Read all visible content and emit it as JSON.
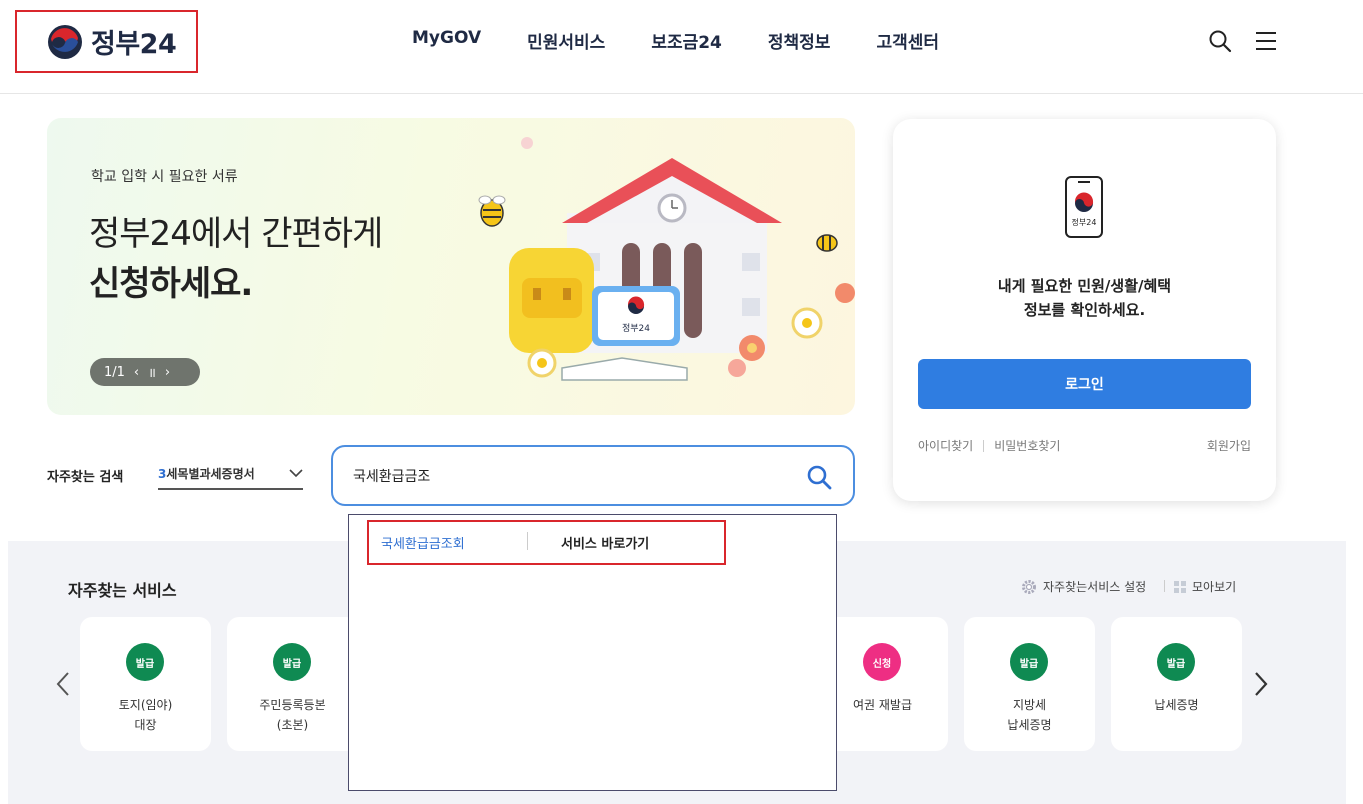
{
  "header": {
    "logo_text": "정부24",
    "nav": [
      "MyGOV",
      "민원서비스",
      "보조금24",
      "정책정보",
      "고객센터"
    ]
  },
  "banner": {
    "subtitle": "학교 입학 시 필요한 서류",
    "title_line1": "정부24에서 간편하게",
    "title_line2": "신청하세요.",
    "pager": "1/1",
    "prev_symbol": "‹",
    "pause_symbol": "॥",
    "next_symbol": "›",
    "art_logo_text": "정부24"
  },
  "login": {
    "phone_text": "정부24",
    "message_line1": "내게 필요한 민원/생활/혜택",
    "message_line2": "정보를 확인하세요.",
    "login_button": "로그인",
    "find_id": "아이디찾기",
    "find_pw": "비밀번호찾기",
    "join": "회원가입"
  },
  "search": {
    "frequent_label": "자주찾는 검색",
    "selected_rank": "3",
    "selected_term": "세목별과세증명서",
    "query": "국세환급금조"
  },
  "autocomplete": {
    "suggestion": "국세환급금조회",
    "goto_label": "서비스 바로가기"
  },
  "services": {
    "title": "자주찾는 서비스",
    "settings_label": "자주찾는서비스 설정",
    "view_all_label": "모아보기",
    "items": [
      {
        "badge": "발급",
        "label": "토지(임야)\n대장",
        "color": "green"
      },
      {
        "badge": "발급",
        "label": "주민등록등본\n(초본)",
        "color": "green"
      },
      {
        "badge": "신청",
        "label": "여권 재발급",
        "color": "pink"
      },
      {
        "badge": "발급",
        "label": "지방세\n납세증명",
        "color": "green"
      },
      {
        "badge": "발급",
        "label": "납세증명",
        "color": "green"
      }
    ]
  },
  "colors": {
    "brand_navy": "#1f2a44",
    "accent_blue": "#2f7de1",
    "highlight_red": "#d9262c",
    "issue_green": "#0f8a52",
    "apply_pink": "#ee2e83"
  }
}
